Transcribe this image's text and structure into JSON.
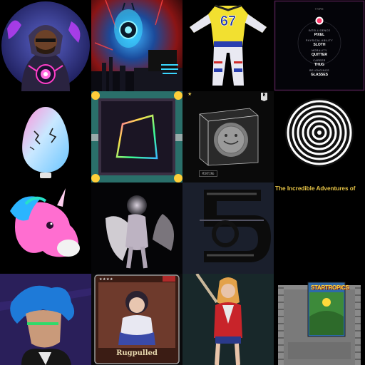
{
  "grid": {
    "columns": 4,
    "rows": 4,
    "tiles": [
      {
        "id": "hooded-figure-avatar"
      },
      {
        "id": "neon-eye-city"
      },
      {
        "id": "football-jersey",
        "jersey_number": "67"
      },
      {
        "id": "attribute-card",
        "type_label": "TYPE",
        "attributes": [
          {
            "key": "INTELLIGENCE",
            "value": "PIXEL"
          },
          {
            "key": "PHYSICAL ABILITY",
            "value": "SLOTH"
          },
          {
            "key": "MORALITY",
            "value": "QUITTER"
          },
          {
            "key": "CAREER",
            "value": "THUG"
          },
          {
            "key": "BELONGINGS",
            "value": "GLASSES"
          }
        ]
      },
      {
        "id": "cracked-egg"
      },
      {
        "id": "neon-frame"
      },
      {
        "id": "glass-cube-coin",
        "badge": "E",
        "plaque": "MINTING"
      },
      {
        "id": "hypnotic-spiral"
      },
      {
        "id": "pink-unicorn"
      },
      {
        "id": "winged-baby"
      },
      {
        "id": "glitch-glyph"
      },
      {
        "id": "incredible-adventures",
        "title": "The Incredible Adventures of"
      },
      {
        "id": "blue-hair-character"
      },
      {
        "id": "rugpulled-card",
        "stars": "★★★★",
        "label": "Rugpulled"
      },
      {
        "id": "harley-character"
      },
      {
        "id": "startropics-cartridge",
        "title": "STARTROPICS"
      }
    ]
  },
  "colors": {
    "background": "#000000",
    "gold": "#e8c547",
    "neon_pink": "#ff3ec8",
    "neon_cyan": "#22d6ff"
  }
}
